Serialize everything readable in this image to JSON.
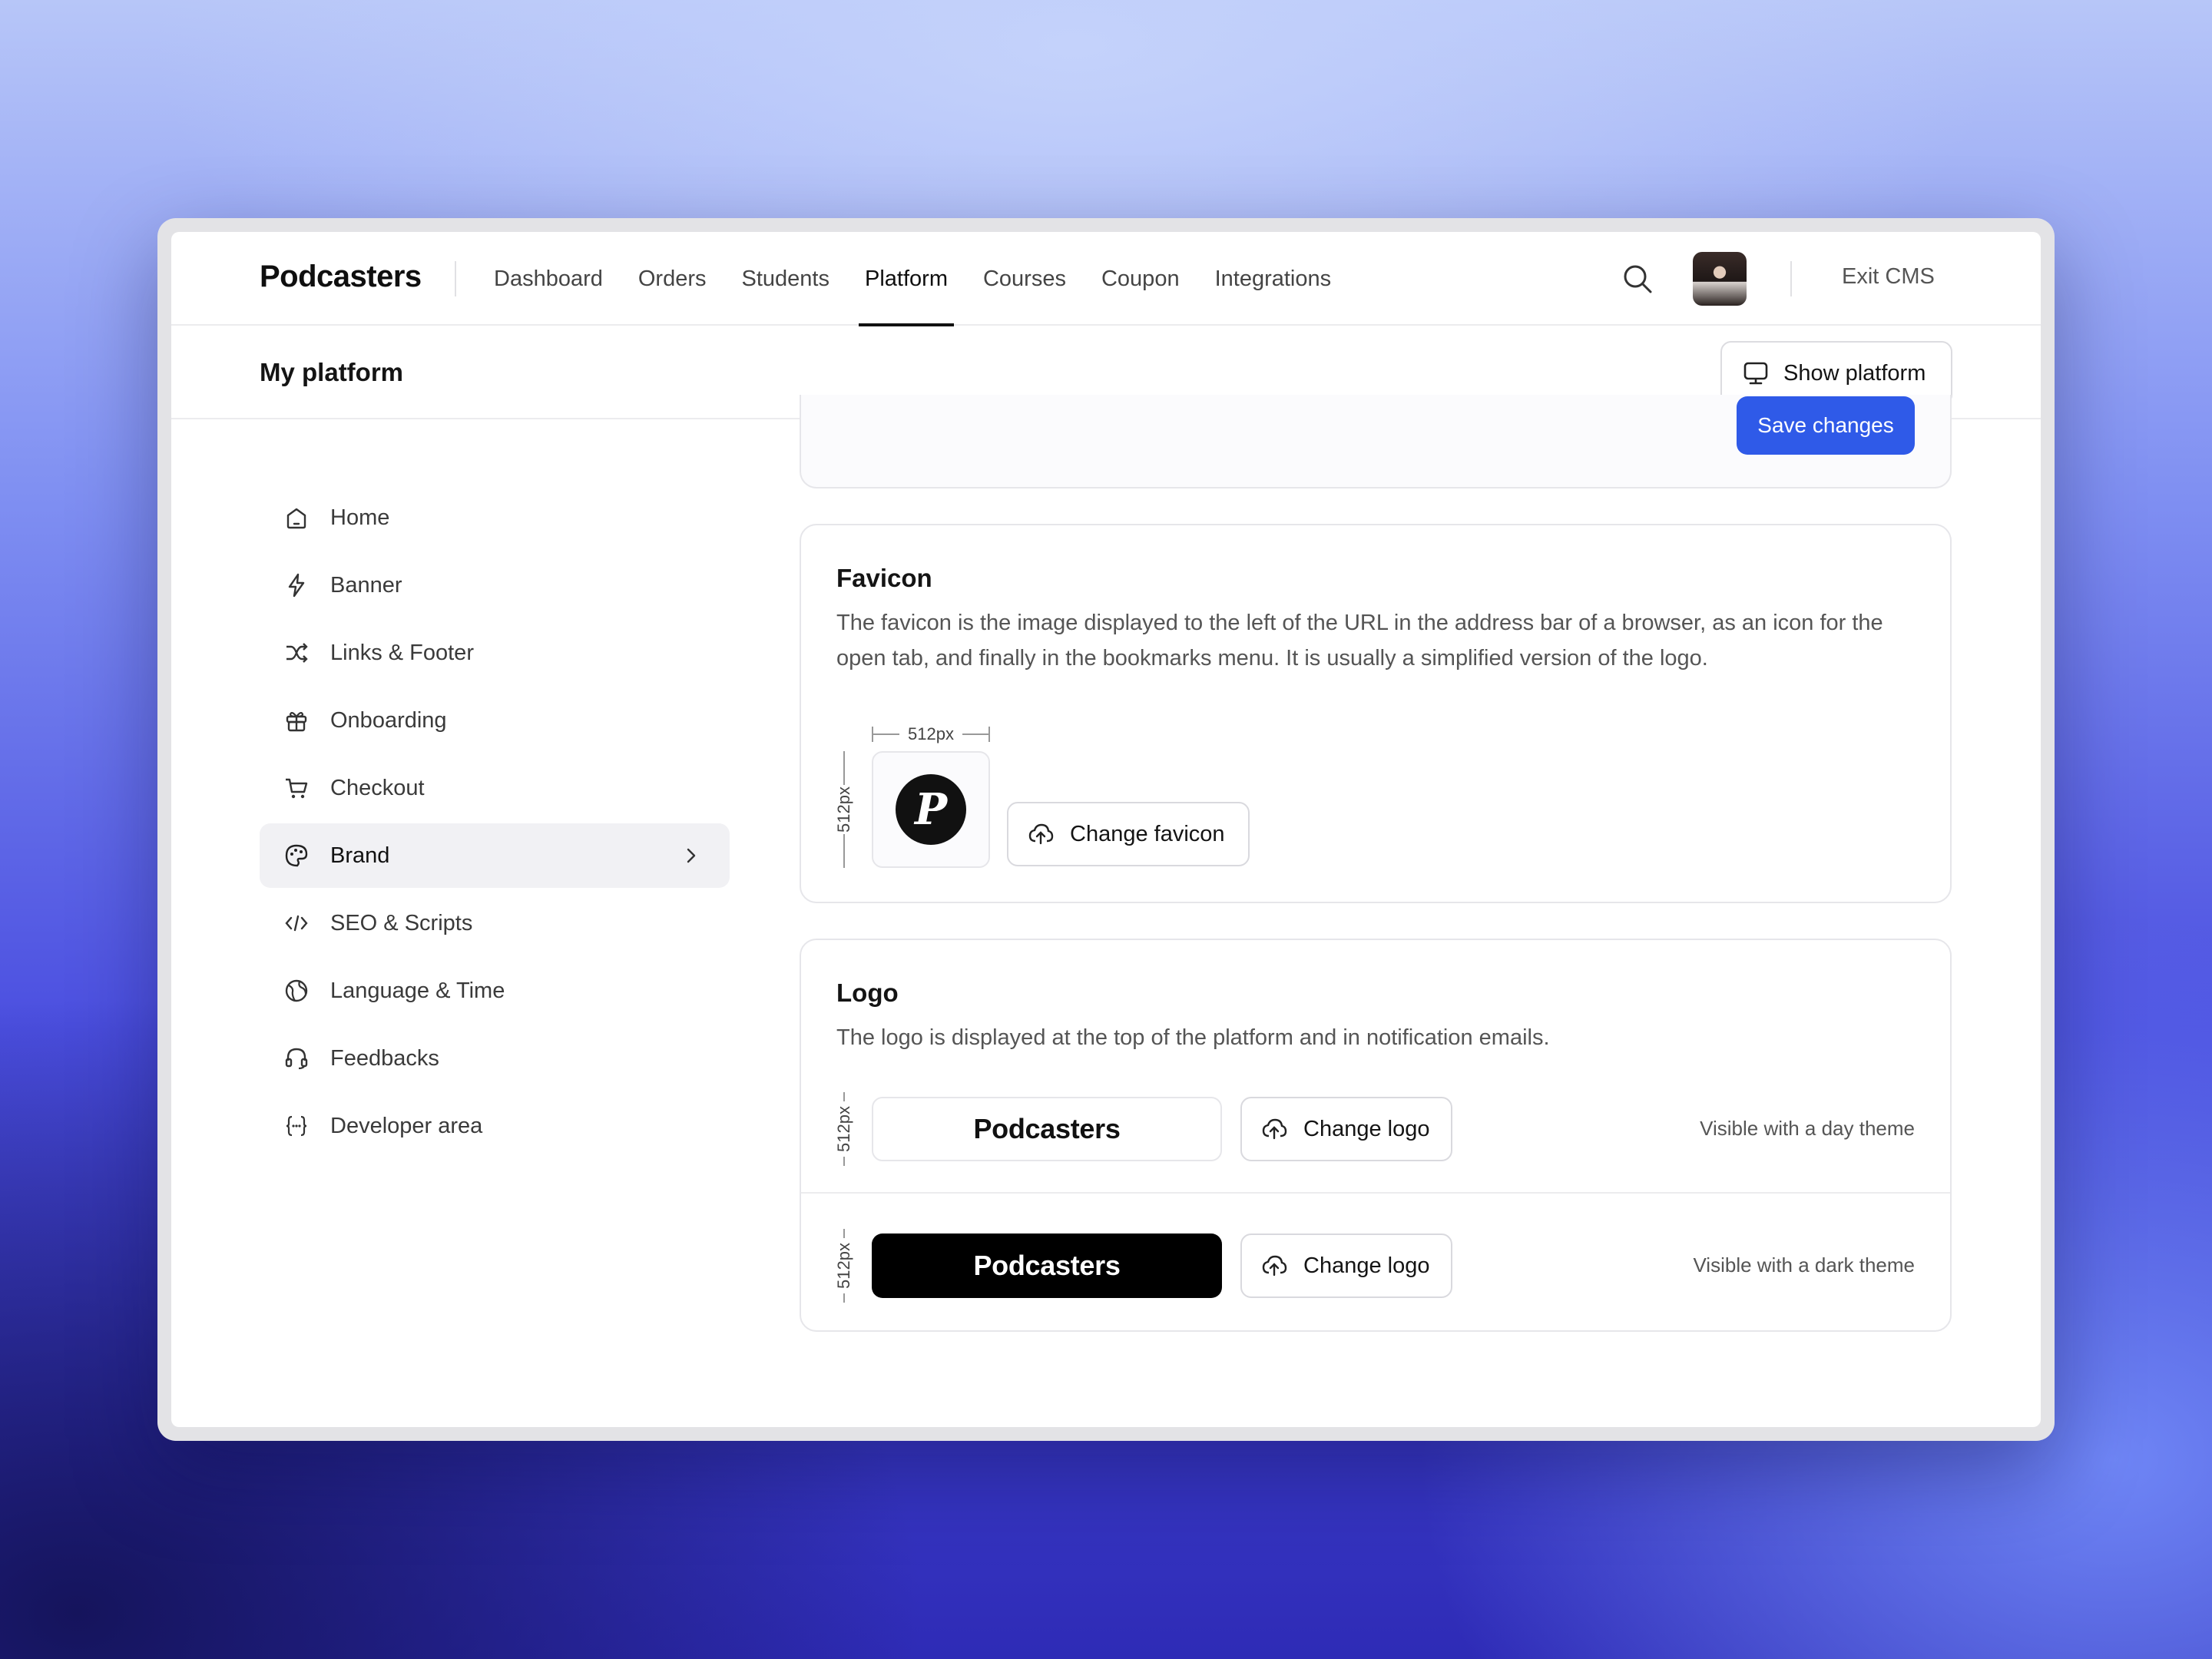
{
  "app": {
    "brand": "Podcasters",
    "nav": [
      "Dashboard",
      "Orders",
      "Students",
      "Platform",
      "Courses",
      "Coupon",
      "Integrations"
    ],
    "active_nav": "Platform",
    "exit_label": "Exit CMS"
  },
  "subheader": {
    "title": "My platform",
    "show_platform_label": "Show platform"
  },
  "sidebar": {
    "items": [
      {
        "label": "Home",
        "icon": "home-icon"
      },
      {
        "label": "Banner",
        "icon": "bolt-icon"
      },
      {
        "label": "Links & Footer",
        "icon": "shuffle-icon"
      },
      {
        "label": "Onboarding",
        "icon": "gift-icon"
      },
      {
        "label": "Checkout",
        "icon": "cart-icon"
      },
      {
        "label": "Brand",
        "icon": "palette-icon"
      },
      {
        "label": "SEO & Scripts",
        "icon": "code-icon"
      },
      {
        "label": "Language & Time",
        "icon": "globe-icon"
      },
      {
        "label": "Feedbacks",
        "icon": "headset-icon"
      },
      {
        "label": "Developer area",
        "icon": "braces-icon"
      }
    ],
    "active_item": "Brand"
  },
  "top_card": {
    "save_label": "Save changes"
  },
  "favicon": {
    "title": "Favicon",
    "description": "The favicon is the image displayed to the left of the URL in the address bar of a browser, as an icon for the open tab, and finally in the bookmarks menu. It is usually a simplified version of the logo.",
    "width_label": "512px",
    "height_label": "512px",
    "glyph": "P",
    "change_label": "Change favicon"
  },
  "logo": {
    "title": "Logo",
    "description": "The logo is displayed at the top of the platform and in notification emails.",
    "rows": [
      {
        "preview_text": "Podcasters",
        "size_label": "512px",
        "change_label": "Change logo",
        "note": "Visible with a day theme"
      },
      {
        "preview_text": "Podcasters",
        "size_label": "512px",
        "change_label": "Change logo",
        "note": "Visible with a dark theme"
      }
    ]
  },
  "colors": {
    "accent": "#2f5ae8",
    "text": "#141414",
    "muted": "#555555",
    "border": "#e6e6ea"
  }
}
